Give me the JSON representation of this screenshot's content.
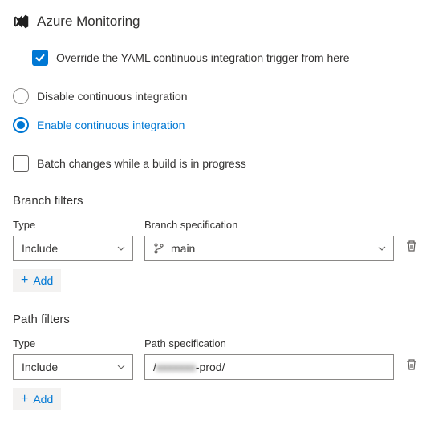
{
  "header": {
    "title": "Azure Monitoring"
  },
  "override": {
    "label": "Override the YAML continuous integration trigger from here",
    "checked": true
  },
  "ci_options": {
    "disable_label": "Disable continuous integration",
    "enable_label": "Enable continuous integration",
    "selected": "enable"
  },
  "batch": {
    "label": "Batch changes while a build is in progress",
    "checked": false
  },
  "branch_filters": {
    "title": "Branch filters",
    "type_label": "Type",
    "spec_label": "Branch specification",
    "rows": [
      {
        "type": "Include",
        "branch": "main"
      }
    ],
    "add_label": "Add"
  },
  "path_filters": {
    "title": "Path filters",
    "type_label": "Type",
    "spec_label": "Path specification",
    "rows": [
      {
        "type": "Include",
        "path_prefix": "/",
        "path_redacted": "xxxxxxx",
        "path_suffix": "-prod/"
      }
    ],
    "add_label": "Add"
  }
}
